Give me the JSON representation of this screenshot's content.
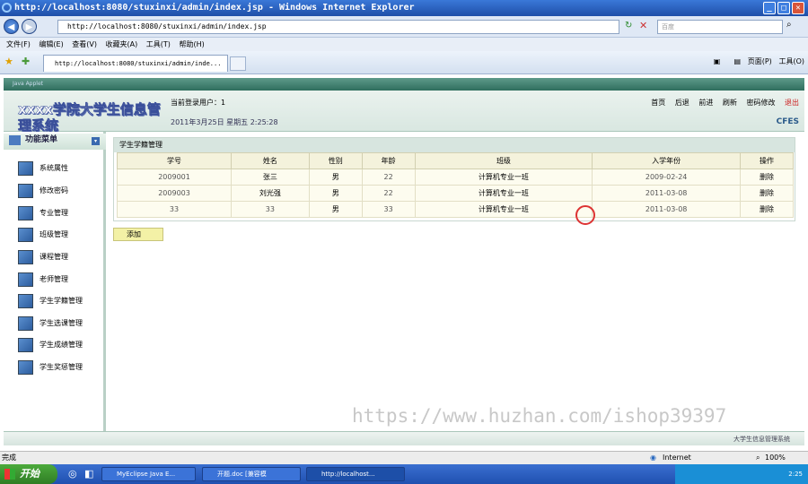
{
  "browser": {
    "title": "http://localhost:8080/stuxinxi/admin/index.jsp - Windows Internet Explorer",
    "address": "http://localhost:8080/stuxinxi/admin/index.jsp",
    "search_placeholder": "百度",
    "menu": [
      "文件(F)",
      "编辑(E)",
      "查看(V)",
      "收藏夹(A)",
      "工具(T)",
      "帮助(H)"
    ],
    "tab_title": "http://localhost:8080/stuxinxi/admin/inde...",
    "commands": {
      "home": "▣",
      "print": "▤",
      "page": "页面(P)",
      "tools": "工具(O)"
    }
  },
  "app": {
    "header_text": "Java Applet",
    "title": "xxxx学院大学生信息管理系统",
    "current_user": "当前登录用户：1",
    "date": "2011年3月25日 星期五  2:25:28",
    "brand": "CFES",
    "top_links": {
      "home": "首页",
      "back": "后退",
      "forward": "前进",
      "refresh": "刷新",
      "password": "密码修改",
      "logout": "退出"
    },
    "menu_title": "功能菜单",
    "menu_items": [
      "系统属性",
      "修改密码",
      "专业管理",
      "班级管理",
      "课程管理",
      "老师管理",
      "学生学籍管理",
      "学生选课管理",
      "学生成绩管理",
      "学生奖惩管理"
    ],
    "footer": "大学生信息管理系统"
  },
  "panel": {
    "title": "学生学籍管理",
    "columns": [
      "学号",
      "姓名",
      "性别",
      "年龄",
      "班级",
      "入学年份",
      "操作"
    ],
    "rows": [
      [
        "2009001",
        "张三",
        "男",
        "22",
        "计算机专业一班",
        "2009-02-24",
        "删除"
      ],
      [
        "2009003",
        "刘光强",
        "男",
        "22",
        "计算机专业一班",
        "2011-03-08",
        "删除"
      ],
      [
        "33",
        "33",
        "男",
        "33",
        "计算机专业一班",
        "2011-03-08",
        "删除"
      ]
    ],
    "add_label": "添加"
  },
  "watermark": "https://www.huzhan.com/ishop39397",
  "status": {
    "left": "完成",
    "zone": "Internet",
    "zoom": "100%"
  },
  "taskbar": {
    "start": "开始",
    "tasks": [
      "MyEclipse Java E...",
      "开题.doc [兼容模",
      "http://localhost..."
    ],
    "clock": "2:25"
  }
}
